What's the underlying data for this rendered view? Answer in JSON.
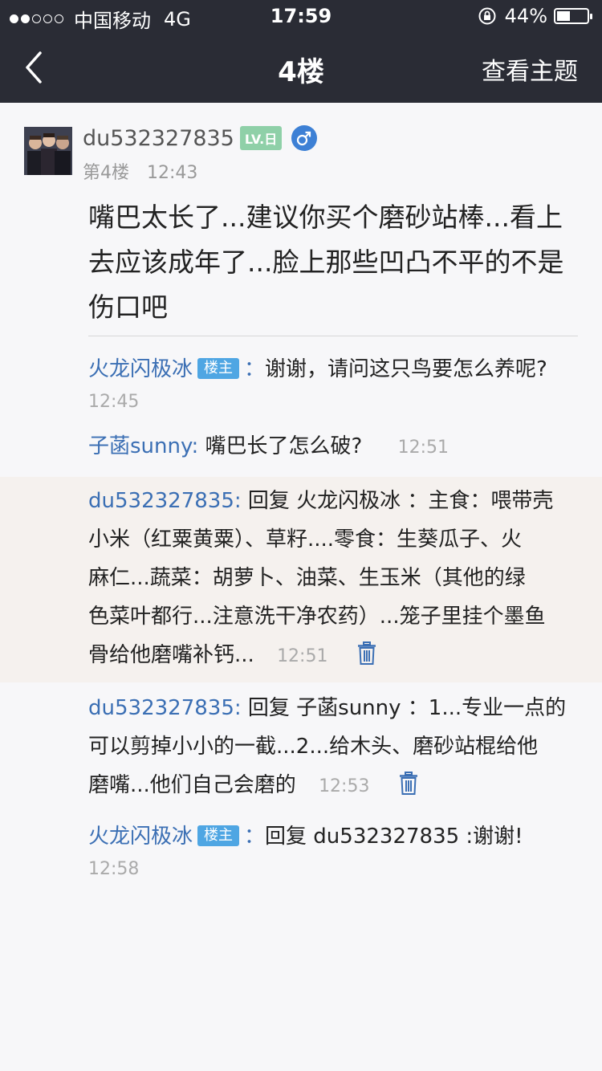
{
  "status": {
    "carrier": "中国移动",
    "network": "4G",
    "time": "17:59",
    "battery": "44%"
  },
  "nav": {
    "title": "4楼",
    "right_action": "查看主题"
  },
  "post": {
    "username": "du532327835",
    "level_badge": "LV.日",
    "floor": "第4楼",
    "time": "12:43",
    "content": "嘴巴太长了...建议你买个磨砂站棒...看上去应该成年了...脸上那些凹凸不平的不是伤口吧"
  },
  "replies": [
    {
      "user": "火龙闪极冰",
      "tag": "楼主",
      "colon": "：",
      "text": "谢谢，请问这只鸟要怎么养呢?",
      "time": "12:45"
    },
    {
      "user": "子菡sunny:",
      "text": "嘴巴长了怎么破?",
      "time": "12:51"
    },
    {
      "user": "du532327835:",
      "lines": [
        "回复 火龙闪极冰 ：主食：喂带壳",
        "小米（红粟黄粟）、草籽....零食：生葵瓜子、火",
        "麻仁...蔬菜：胡萝卜、油菜、生玉米（其他的绿",
        "色菜叶都行...注意洗干净农药）...笼子里挂个墨鱼"
      ],
      "last": "骨给他磨嘴补钙...",
      "time": "12:51"
    },
    {
      "user": "du532327835:",
      "lines": [
        "回复 子菡sunny ：1...专业一点的",
        "可以剪掉小小的一截...2...给木头、磨砂站棍给他"
      ],
      "last": "磨嘴...他们自己会磨的",
      "time": "12:53"
    },
    {
      "user": "火龙闪极冰",
      "tag": "楼主",
      "colon": "：",
      "text": "回复 du532327835 :谢谢!",
      "time": "12:58"
    }
  ]
}
